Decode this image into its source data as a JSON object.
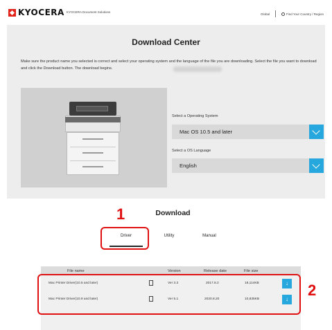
{
  "header": {
    "logo": "KYOCERA",
    "logo_sub": "KYOCERA Document Solutions",
    "global_link": "Global",
    "country_link": "Find Your Country / Region",
    "globe_icon": "globe-icon"
  },
  "hero": {
    "title": "Download Center",
    "description": "Make sure the product name you selected is correct and select your operating system and the language of the file you are downloading. Select the file you want to download and click the Download button. The download begins.",
    "os_label": "Select a Operating System",
    "os_value": "Mac OS 10.5 and later",
    "lang_label": "Select a OS Language",
    "lang_value": "English",
    "accent_color": "#26a7de"
  },
  "markers": {
    "one": "1",
    "two": "2",
    "color": "#e01010"
  },
  "download": {
    "title": "Download",
    "tabs": [
      "Driver",
      "Utility",
      "Manual"
    ],
    "active_tab": "Driver"
  },
  "table": {
    "headers": [
      "File name",
      "Version",
      "Release date",
      "File size"
    ],
    "rows": [
      {
        "name": "Mac Printer Driver(10.5 and later)",
        "version": "Ver 3.3",
        "date": "2017.8.2",
        "size": "18,114KB"
      },
      {
        "name": "Mac Printer Driver(10.9 and later)",
        "version": "Ver 5.1",
        "date": "2020.8.20",
        "size": "10,835KB"
      }
    ],
    "download_icon": "download-arrow-icon",
    "file_icon": "document-icon"
  }
}
